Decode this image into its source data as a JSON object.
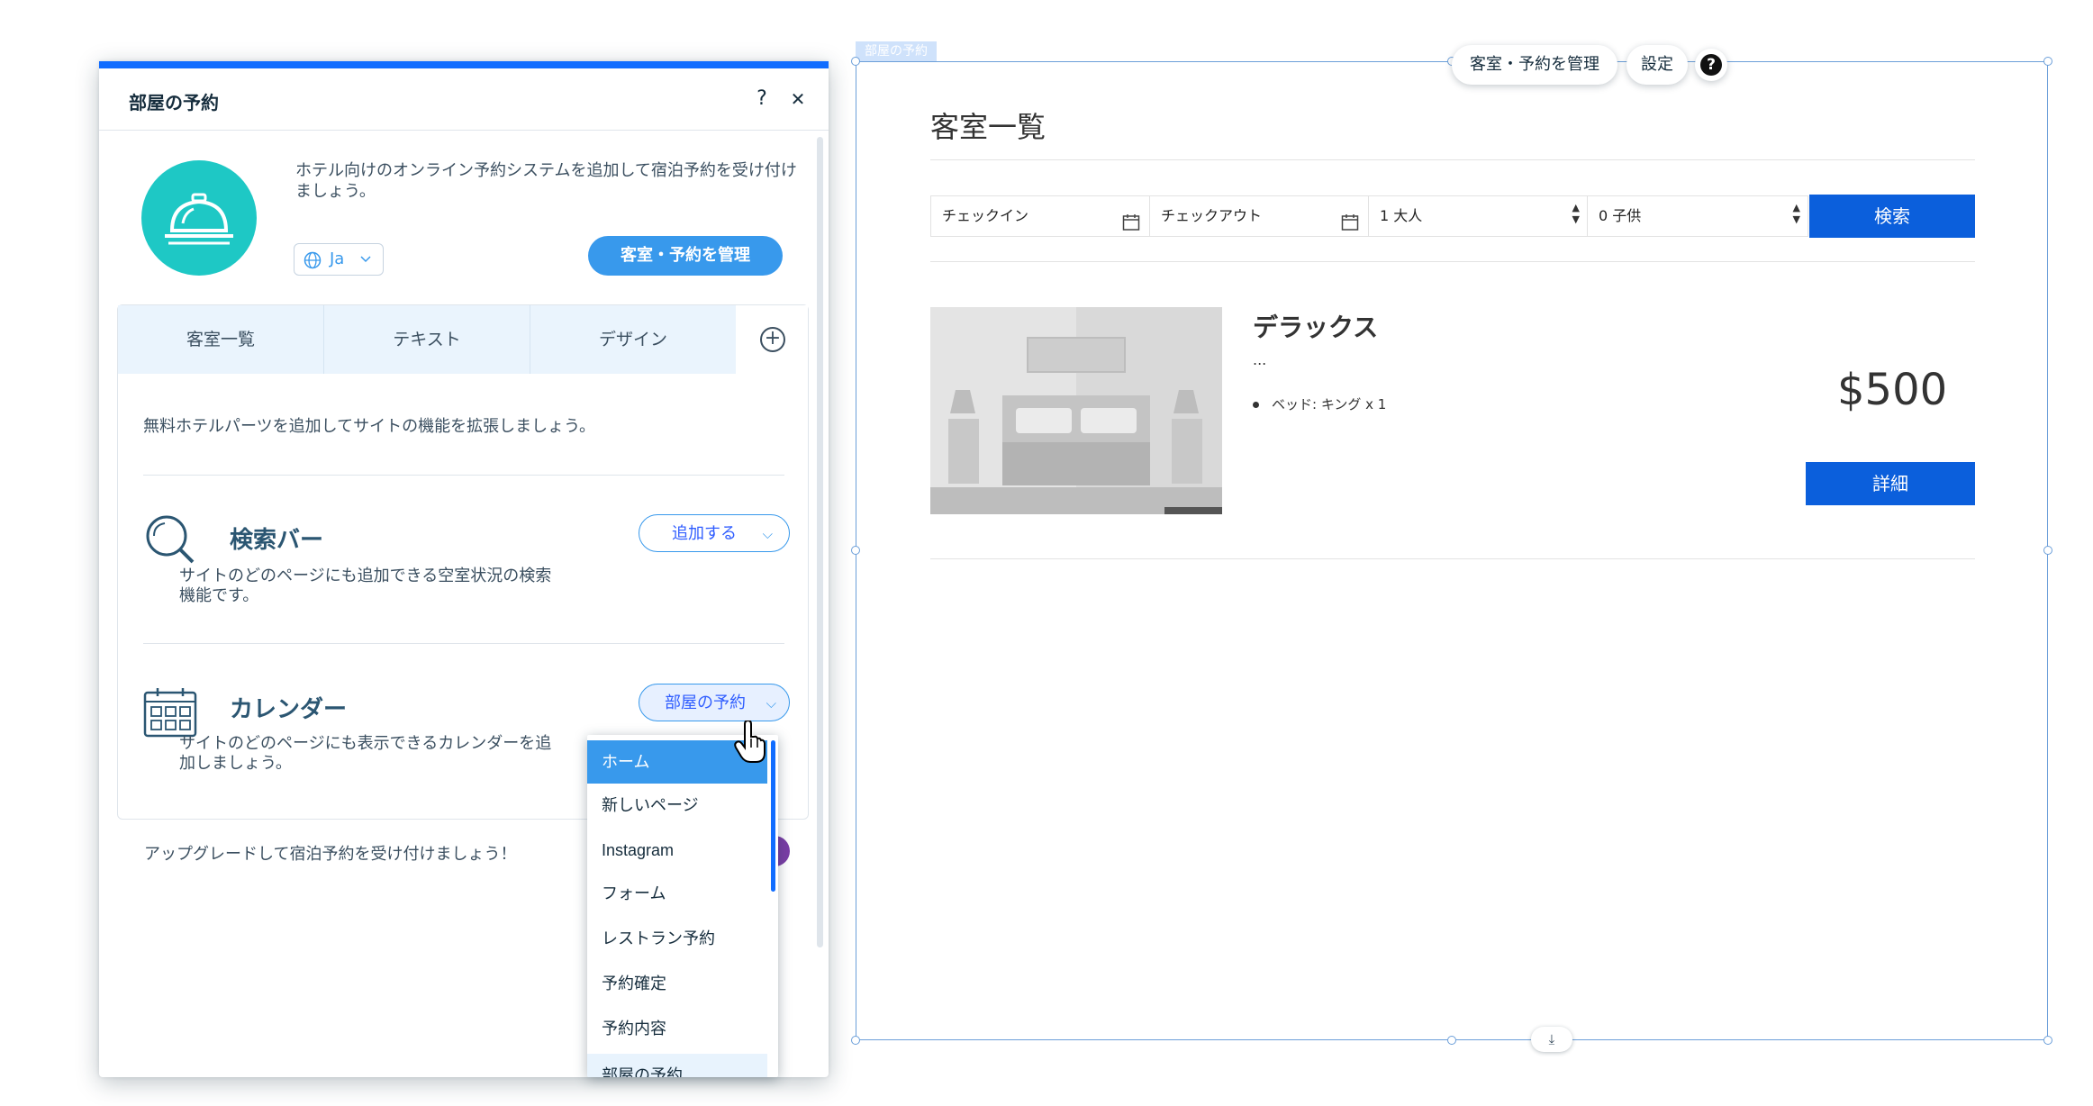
{
  "panel": {
    "title": "部屋の予約",
    "help_label": "?",
    "close_label": "✕",
    "intro_text": "ホテル向けのオンライン予約システムを追加して宿泊予約を受け付けましょう。",
    "lang_label": "Ja",
    "manage_label": "客室・予約を管理",
    "tabs": [
      {
        "label": "客室一覧"
      },
      {
        "label": "テキスト"
      },
      {
        "label": "デザイン"
      }
    ],
    "tab_add_label": "+",
    "subtitle": "無料ホテルパーツを追加してサイトの機能を拡張しましょう。",
    "features": [
      {
        "title": "検索バー",
        "desc": "サイトのどのページにも追加できる空室状況の検索機能です。",
        "button": "追加する"
      },
      {
        "title": "カレンダー",
        "desc": "サイトのどのページにも表示できるカレンダーを追加しましょう。",
        "button": "部屋の予約"
      }
    ],
    "footer": "アップグレードして宿泊予約を受け付けましょう！"
  },
  "dropdown": {
    "items": [
      "ホーム",
      "新しいページ",
      "Instagram",
      "フォーム",
      "レストラン予約",
      "予約確定",
      "予約内容",
      "部屋の予約"
    ],
    "selected_index": 0
  },
  "widget": {
    "label": "部屋の予約",
    "toolbar": {
      "manage": "客室・予約を管理",
      "settings": "設定",
      "help": "?"
    },
    "title": "客室一覧",
    "search": {
      "checkin": "チェックイン",
      "checkout": "チェックアウト",
      "adults": "1 大人",
      "children": "0 子供",
      "button": "検索"
    },
    "room": {
      "name": "デラックス",
      "desc": "...",
      "feature": "ベッド: キング x 1",
      "price": "$500",
      "details": "詳細"
    }
  },
  "colors": {
    "accent": "#3899ec",
    "brand_blue": "#116dff",
    "button_blue": "#0b5fdc",
    "teal": "#1ec8c5"
  }
}
